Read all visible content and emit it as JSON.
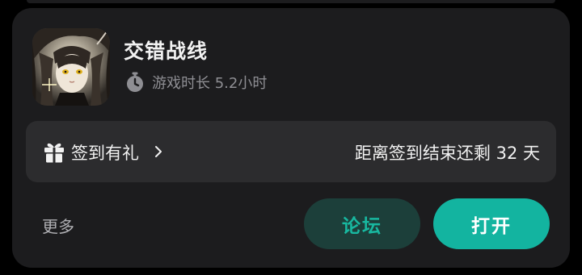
{
  "game": {
    "title": "交错战线",
    "playtime_text": "游戏时长 5.2小时",
    "icon": "game-artwork-dark-haired-character"
  },
  "checkin": {
    "label": "签到有礼",
    "countdown_text": "距离签到结束还剩 32 天",
    "icon": "gift-icon"
  },
  "footer": {
    "more_label": "更多",
    "forum_label": "论坛",
    "open_label": "打开"
  },
  "colors": {
    "accent": "#13b4a0",
    "forum_bg": "#1c3f3a",
    "forum_text": "#18b8a0",
    "card_bg": "#1c1c1e",
    "bar_bg": "#2c2c2e"
  }
}
